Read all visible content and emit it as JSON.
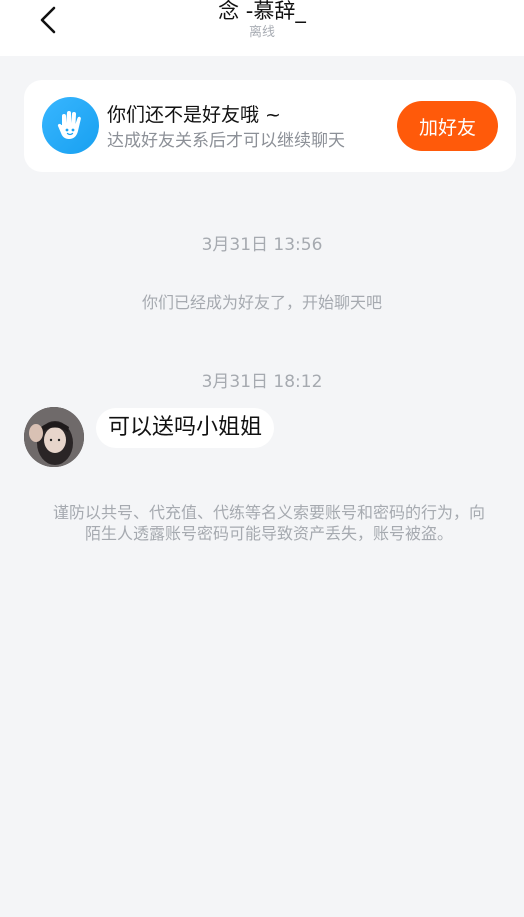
{
  "header": {
    "title": "念 -慕辞_",
    "status": "离线"
  },
  "friend_card": {
    "title": "你们还不是好友哦 ~",
    "subtitle": "达成好友关系后才可以继续聊天",
    "button_label": "加好友",
    "icon": "hand-icon"
  },
  "chat": {
    "timestamp_1": "3月31日 13:56",
    "system_message": "你们已经成为好友了，开始聊天吧",
    "timestamp_2": "3月31日 18:12",
    "message_text": "可以送吗小姐姐"
  },
  "warning": {
    "text": "谨防以共号、代充值、代练等名义索要账号和密码的行为，向陌生人透露账号密码可能导致资产丢失，账号被盗。"
  },
  "colors": {
    "background": "#f4f5f7",
    "accent_orange": "#ff5a0a",
    "accent_blue": "#1aa3f2"
  }
}
